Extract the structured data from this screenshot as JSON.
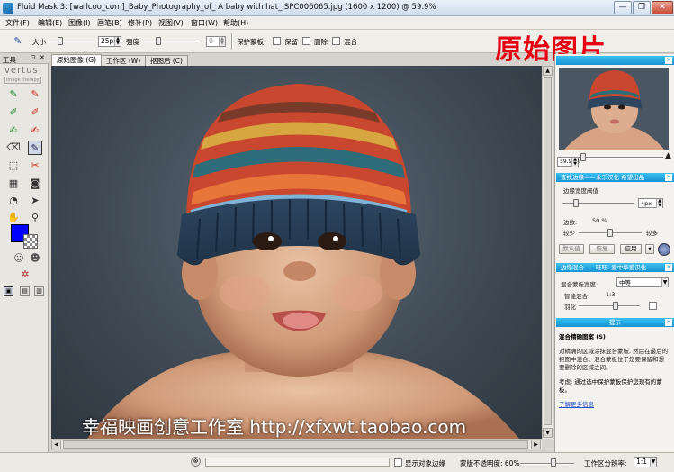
{
  "window": {
    "title": "Fluid Mask 3: [wallcoo_com]_Baby_Photography_of_ A baby with hat_ISPC006065.jpg (1600 x 1200) @ 59.9%",
    "min": "—",
    "max": "❐",
    "close": "✕"
  },
  "menu": [
    "文件(F)",
    "编辑(E)",
    "图像(I)",
    "画笔(B)",
    "修补(P)",
    "视图(V)",
    "窗口(W)",
    "帮助(H)"
  ],
  "toolbar": {
    "size_label": "大小",
    "size_value": "25px",
    "strength_label": "强度",
    "strength_value": "0",
    "protect_label": "保护蒙板:",
    "keep_label": "保留",
    "delete_label": "删除",
    "blend_label": "混合"
  },
  "tools_panel": {
    "title": "工具",
    "brand": "vertus",
    "brand_sub": "image therapy",
    "fg_color": "#0000ff",
    "bg_color": "#ffffff"
  },
  "tabs": [
    "原始图像 (G)",
    "工作区 (W)",
    "抠图后 (C)"
  ],
  "canvas": {
    "watermark": "幸福映画创意工作室 http://xfxwt.taobao.com"
  },
  "overlay_label": "原始图片",
  "right_panel": {
    "zoom_value": "59.90%",
    "edge_header": "查找边缘——永乐汉化 希望出品",
    "edge_width_label": "边缘宽度阀值",
    "edge_width_value": "4px",
    "contrast_label": "边数:",
    "contrast_value": "50 %",
    "less_label": "较少",
    "more_label": "较多",
    "default_btn": "默认值",
    "restore_btn": "恢复",
    "apply_btn": "应用",
    "blend_header": "边缘混合——旺旺: 爱中华爱汉化",
    "blend_width_label": "混合蒙板宽度:",
    "blend_width_value": "中等",
    "smart_label": "智能混合:",
    "smart_value": "1:3",
    "feather_label": "羽化",
    "hint_header": "提示",
    "hint_title": "混合精确图案 (S)",
    "hint_body": "对精确的区域涂抹混合蒙板, 然后在最后的抠图中混合。混合蒙板位于您要保留和想要删除的区域之间。",
    "hint_tip": "考虑: 通过选中保护蒙板保护您现有的蒙板。",
    "hint_link": "了解更多信息"
  },
  "status": {
    "show_edges_label": "显示对象边缘",
    "opacity_label": "蒙版不透明度: 60%",
    "resolution_label": "工作区分辨率:",
    "resolution_value": "1:1"
  }
}
